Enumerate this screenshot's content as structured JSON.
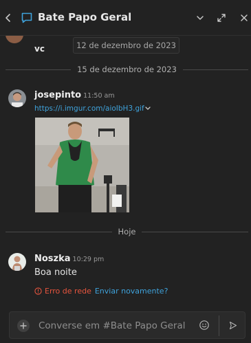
{
  "header": {
    "title": "Bate Papo Geral",
    "icons": [
      "back-icon",
      "chat-bubble-icon",
      "chevron-down-icon",
      "expand-icon",
      "close-icon"
    ]
  },
  "floating_date": "12 de dezembro de 2023",
  "previous_message": {
    "text": "vc"
  },
  "separators": {
    "first": "15 de dezembro de 2023",
    "today": "Hoje"
  },
  "messages": [
    {
      "username": "josepinto",
      "time": "11:50 am",
      "link": "https://i.imgur.com/aioIbH3.gif"
    },
    {
      "username": "Noszka",
      "time": "10:29 pm",
      "text": "Boa noite",
      "error_text": "Erro de rede",
      "resend_label": "Enviar novamente?"
    }
  ],
  "composer": {
    "placeholder": "Converse em #Bate Papo Geral"
  },
  "colors": {
    "background": "#222222",
    "link": "#3fa3dc",
    "error": "#e8553e",
    "accent_icon": "#3fa3dc"
  }
}
